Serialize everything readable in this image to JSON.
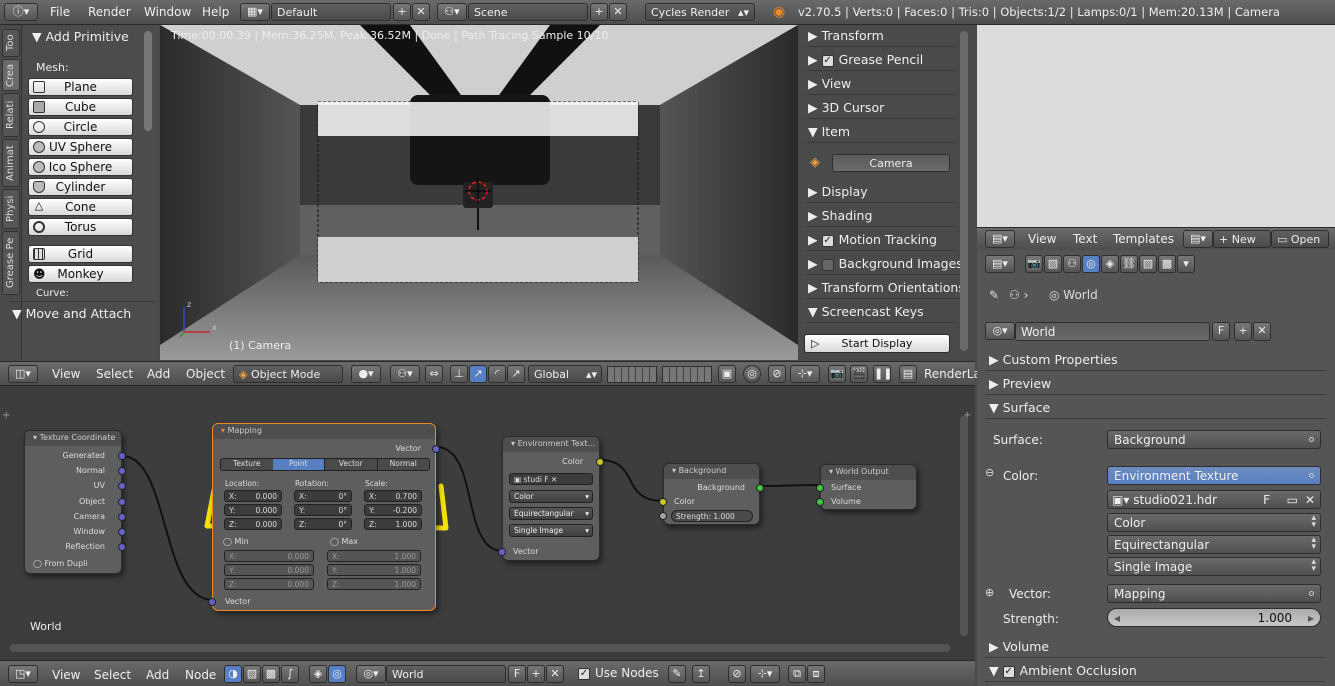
{
  "topbar": {
    "menus": [
      "File",
      "Render",
      "Window",
      "Help"
    ],
    "screen_layout": "Default",
    "scene": "Scene",
    "engine": "Cycles Render",
    "stats": "v2.70.5 | Verts:0 | Faces:0 | Tris:0 | Objects:1/2 | Lamps:0/1 | Mem:20.13M | Camera"
  },
  "lefttabs": [
    "Too",
    "Crea",
    "Relati",
    "Animat",
    "Physi",
    "Grease Pe"
  ],
  "toolshelf": {
    "title": "Add Primitive",
    "mesh_label": "Mesh:",
    "items": [
      "Plane",
      "Cube",
      "Circle",
      "UV Sphere",
      "Ico Sphere",
      "Cylinder",
      "Cone",
      "Torus"
    ],
    "extra": [
      "Grid",
      "Monkey"
    ],
    "curve_label": "Curve:",
    "move_attach": "Move and Attach"
  },
  "viewport": {
    "status": "Time:00:00.39 | Mem:36.25M, Peak:36.52M | Done | Path Tracing Sample 10/10",
    "object_label": "(1) Camera",
    "axis_z": "z",
    "axis_x": "x"
  },
  "npanel": {
    "sections": [
      "Transform",
      "Grease Pencil",
      "View",
      "3D Cursor",
      "Item",
      "Display",
      "Shading",
      "Motion Tracking",
      "Background Images",
      "Transform Orientations",
      "Screencast Keys"
    ],
    "item_name": "Camera",
    "start_display": "Start Display"
  },
  "view3d_header": {
    "view": "View",
    "select": "Select",
    "add": "Add",
    "object": "Object",
    "mode": "Object Mode",
    "orientation": "Global",
    "render_layer": "RenderLay"
  },
  "nodes": {
    "texcoord": {
      "title": "Texture Coordinate",
      "outputs": [
        "Generated",
        "Normal",
        "UV",
        "Object",
        "Camera",
        "Window",
        "Reflection"
      ],
      "from_dupli": "From Dupli"
    },
    "mapping": {
      "title": "Mapping",
      "out": "Vector",
      "tabs": [
        "Texture",
        "Point",
        "Vector",
        "Normal"
      ],
      "active_tab": "Point",
      "location_label": "Location:",
      "rotation_label": "Rotation:",
      "scale_label": "Scale:",
      "location": {
        "X": "0.000",
        "Y": "0.000",
        "Z": "0.000"
      },
      "rotation": {
        "X": "0°",
        "Y": "0°",
        "Z": "0°"
      },
      "scale": {
        "X": "0.700",
        "Y": "-0.200",
        "Z": "1.000"
      },
      "min_label": "Min",
      "max_label": "Max",
      "min": {
        "X": "0.000",
        "Y": "0.000",
        "Z": "0.000"
      },
      "max": {
        "X": "1.000",
        "Y": "1.000",
        "Z": "1.000"
      },
      "in": "Vector"
    },
    "envtex": {
      "title": "Environment Text...",
      "out": "Color",
      "image": "studi",
      "color": "Color",
      "projection": "Equirectangular",
      "mode": "Single Image",
      "in": "Vector"
    },
    "background": {
      "title": "Background",
      "out": "Background",
      "color": "Color",
      "strength": "Strength: 1.000"
    },
    "output": {
      "title": "World Output",
      "surface": "Surface",
      "volume": "Volume"
    },
    "world_label": "World"
  },
  "node_header": {
    "view": "View",
    "select": "Select",
    "add": "Add",
    "node": "Node",
    "world": "World",
    "use_nodes": "Use Nodes",
    "f": "F"
  },
  "text_header": {
    "view": "View",
    "text": "Text",
    "templates": "Templates",
    "new": "New",
    "open": "Open"
  },
  "props": {
    "breadcrumb": "World",
    "world_name": "World",
    "f": "F",
    "sections": {
      "custom": "Custom Properties",
      "preview": "Preview",
      "surface": "Surface",
      "volume": "Volume",
      "ao": "Ambient Occlusion"
    },
    "surface_label": "Surface:",
    "surface_value": "Background",
    "color_label": "Color:",
    "color_value": "Environment Texture",
    "image": "studio021.hdr",
    "color_space": "Color",
    "projection": "Equirectangular",
    "source": "Single Image",
    "vector_label": "Vector:",
    "vector_value": "Mapping",
    "strength_label": "Strength:",
    "strength_value": "1.000"
  },
  "colors": {
    "accent": "#5680c2",
    "highlight": "#f5e400",
    "node_selected": "#f08a24"
  }
}
